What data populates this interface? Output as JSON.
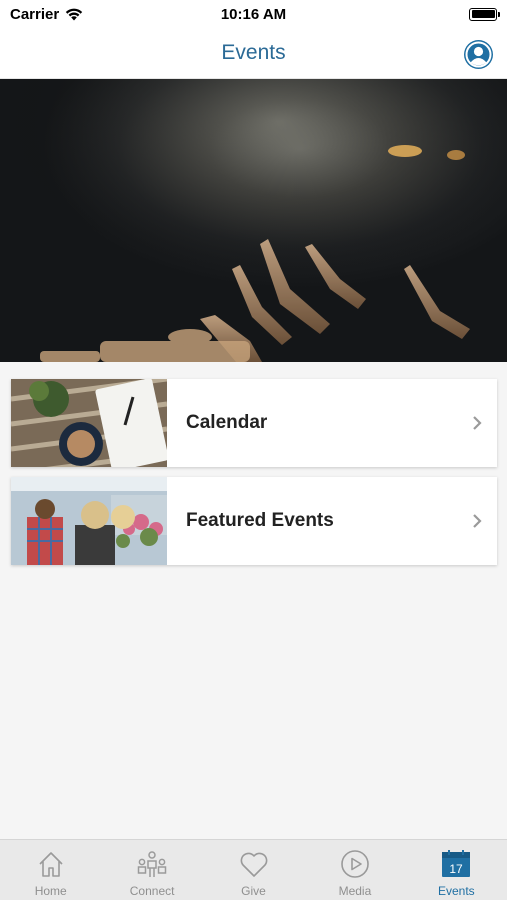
{
  "status_bar": {
    "carrier": "Carrier",
    "time": "10:16 AM"
  },
  "nav": {
    "title": "Events",
    "profile_icon": "user-circle-icon"
  },
  "hero": {
    "image": "concert-crowd-hands-raised"
  },
  "cards": [
    {
      "label": "Calendar",
      "thumbnail": "notebook-coffee-table-photo"
    },
    {
      "label": "Featured Events",
      "thumbnail": "outdoor-market-people-photo"
    }
  ],
  "tabs": [
    {
      "label": "Home",
      "icon": "home-icon",
      "active": false
    },
    {
      "label": "Connect",
      "icon": "people-icon",
      "active": false
    },
    {
      "label": "Give",
      "icon": "heart-icon",
      "active": false
    },
    {
      "label": "Media",
      "icon": "play-circle-icon",
      "active": false
    },
    {
      "label": "Events",
      "icon": "calendar-icon",
      "active": true,
      "badge": "17"
    }
  ],
  "colors": {
    "accent": "#1f6fa3",
    "title": "#2b6a96",
    "tab_inactive": "#8f8f8f",
    "background": "#f5f5f5"
  }
}
